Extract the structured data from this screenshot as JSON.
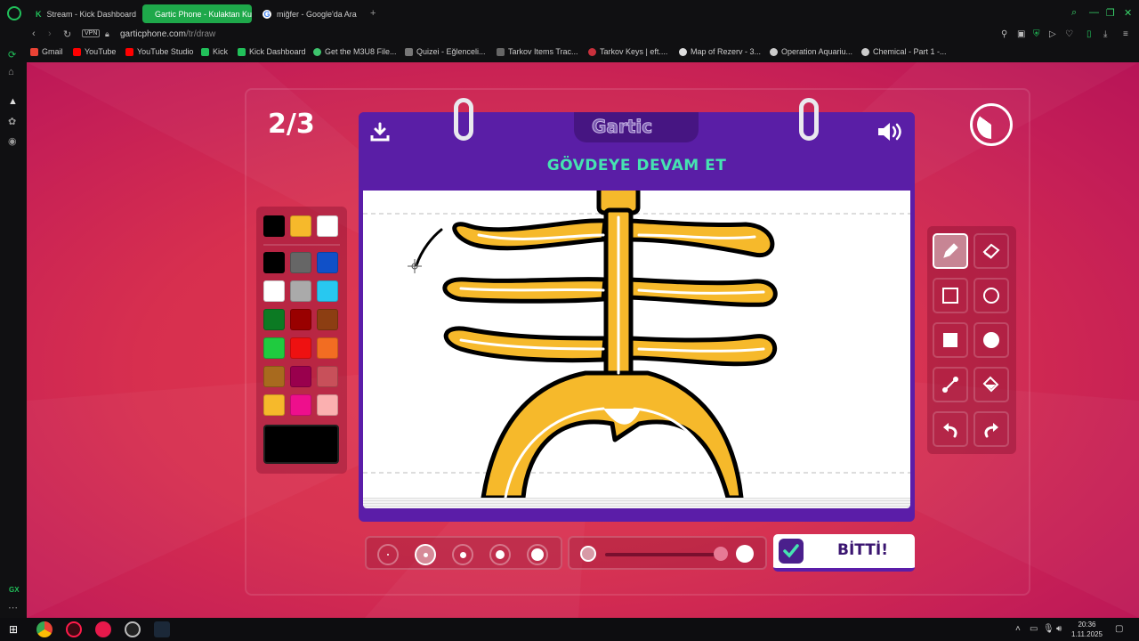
{
  "browser": {
    "tabs": [
      {
        "title": "Stream - Kick Dashboard",
        "active": false
      },
      {
        "title": "Gartic Phone - Kulaktan Kulağa",
        "active": true
      },
      {
        "title": "miğfer - Google'da Ara",
        "active": false
      }
    ],
    "new_tab": "+",
    "vpn": "VPN",
    "url_host": "garticphone.com",
    "url_path": "/tr/draw",
    "bookmarks": [
      "Gmail",
      "YouTube",
      "YouTube Studio",
      "Kick",
      "Kick Dashboard",
      "Get the M3U8 File...",
      "Quizei - Eğlenceli...",
      "Tarkov Items Trac...",
      "Tarkov Keys | eft....",
      "Map of Rezerv - 3...",
      "Operation Aquariu...",
      "Chemical - Part 1 -..."
    ],
    "sidebar_label": "GX"
  },
  "game": {
    "round": "2/3",
    "logo": "Gartic",
    "prompt": "GÖVDEYE DEVAM ET",
    "done_label": "BİTTİ!",
    "palette": {
      "top_colors": [
        "#000000",
        "#f6b92b",
        "#ffffff"
      ],
      "colors": [
        "#000000",
        "#666666",
        "#1050c8",
        "#ffffff",
        "#aaaaaa",
        "#28c8f0",
        "#0c7a23",
        "#990000",
        "#8c3e12",
        "#1fcb3f",
        "#ee1111",
        "#f26d22",
        "#a86a1e",
        "#99004d",
        "#c8505a",
        "#f6b92b",
        "#ee0f8c",
        "#fbb0b0"
      ],
      "current": "#000000"
    },
    "tools": [
      "pen-icon",
      "eraser-icon",
      "rectangle-outline-icon",
      "ellipse-outline-icon",
      "rectangle-filled-icon",
      "ellipse-filled-icon",
      "line-icon",
      "fill-bucket-icon",
      "undo-icon",
      "redo-icon"
    ],
    "active_tool": "pen-icon",
    "brush_sizes": 5,
    "active_brush_size": 2
  },
  "taskbar": {
    "time": "20:36",
    "date": "1.11.2025"
  }
}
